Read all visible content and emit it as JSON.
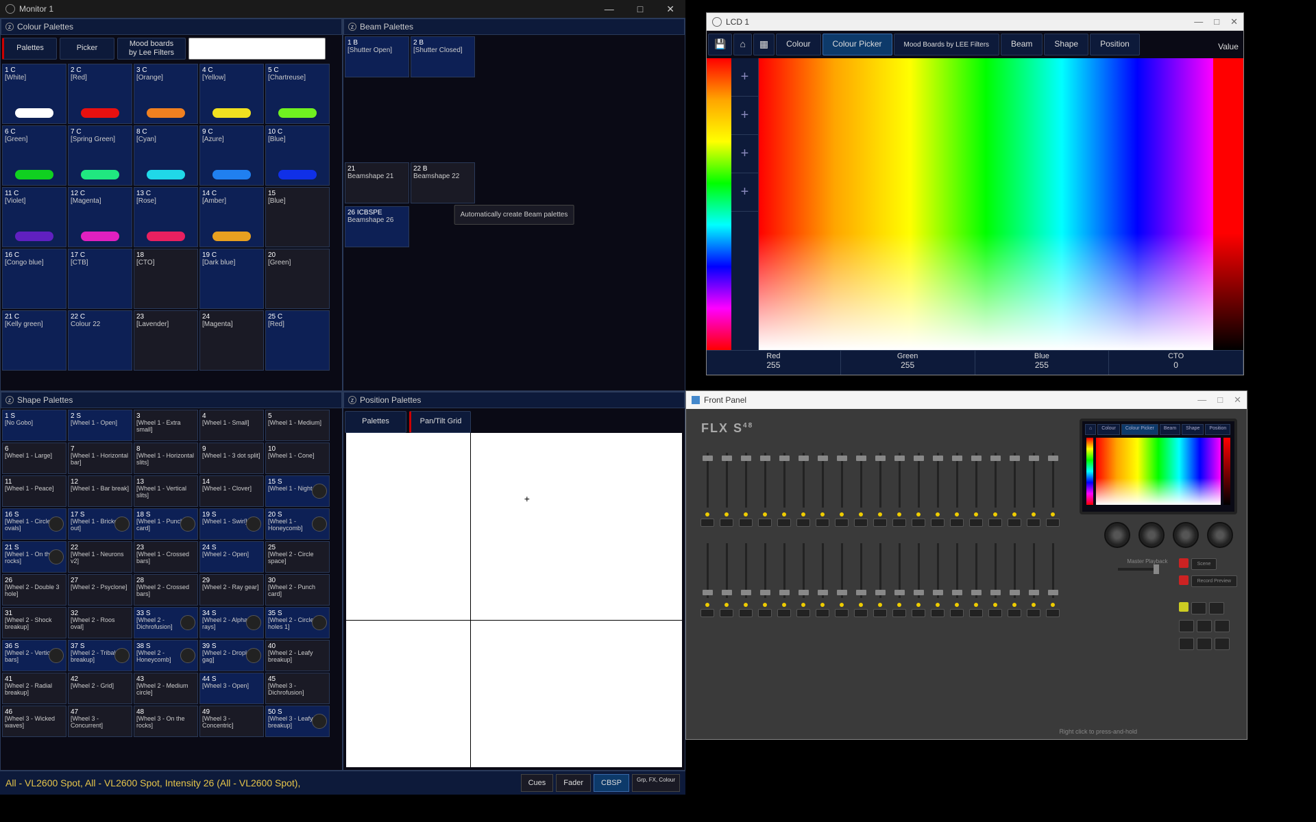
{
  "monitor1": {
    "title": "Monitor 1",
    "colour_panel": {
      "header": "Colour Palettes",
      "tabs": {
        "palettes": "Palettes",
        "picker": "Picker",
        "mood": "Mood boards by Lee Filters"
      },
      "cells": [
        {
          "num": "1 C",
          "name": "[White]",
          "color": "#ffffff"
        },
        {
          "num": "2 C",
          "name": "[Red]",
          "color": "#e81010"
        },
        {
          "num": "3 C",
          "name": "[Orange]",
          "color": "#f08020"
        },
        {
          "num": "4 C",
          "name": "[Yellow]",
          "color": "#f0e020"
        },
        {
          "num": "5 C",
          "name": "[Chartreuse]",
          "color": "#70f020"
        },
        {
          "num": "6 C",
          "name": "[Green]",
          "color": "#10d020"
        },
        {
          "num": "7 C",
          "name": "[Spring Green]",
          "color": "#20e880"
        },
        {
          "num": "8 C",
          "name": "[Cyan]",
          "color": "#20d8e8"
        },
        {
          "num": "9 C",
          "name": "[Azure]",
          "color": "#2080f0"
        },
        {
          "num": "10 C",
          "name": "[Blue]",
          "color": "#1030e8"
        },
        {
          "num": "11 C",
          "name": "[Violet]",
          "color": "#6020c0"
        },
        {
          "num": "12 C",
          "name": "[Magenta]",
          "color": "#e020c0"
        },
        {
          "num": "13 C",
          "name": "[Rose]",
          "color": "#e82060"
        },
        {
          "num": "14 C",
          "name": "[Amber]",
          "color": "#e8a020"
        },
        {
          "num": "15",
          "name": "[Blue]",
          "dark": true
        },
        {
          "num": "16 C",
          "name": "[Congo blue]"
        },
        {
          "num": "17 C",
          "name": "[CTB]"
        },
        {
          "num": "18",
          "name": "[CTO]",
          "dark": true
        },
        {
          "num": "19 C",
          "name": "[Dark blue]"
        },
        {
          "num": "20",
          "name": "[Green]",
          "dark": true
        },
        {
          "num": "21 C",
          "name": "[Kelly green]"
        },
        {
          "num": "22 C",
          "name": "Colour 22"
        },
        {
          "num": "23",
          "name": "[Lavender]",
          "dark": true
        },
        {
          "num": "24",
          "name": "[Magenta]",
          "dark": true
        },
        {
          "num": "25 C",
          "name": "[Red]"
        }
      ]
    },
    "beam_panel": {
      "header": "Beam Palettes",
      "cells1": [
        {
          "num": "1 B",
          "name": "[Shutter Open]"
        },
        {
          "num": "2 B",
          "name": "[Shutter Closed]"
        }
      ],
      "cells2": [
        {
          "num": "21",
          "name": "Beamshape 21",
          "dark": true
        },
        {
          "num": "22 B",
          "name": "Beamshape 22",
          "dark": true
        }
      ],
      "cells3": [
        {
          "num": "26 ICBSPE",
          "name": "Beamshape 26"
        }
      ],
      "auto_btn": "Automatically create Beam palettes"
    },
    "shape_panel": {
      "header": "Shape Palettes",
      "cells": [
        {
          "num": "1 S",
          "name": "[No Gobo]"
        },
        {
          "num": "2 S",
          "name": "[Wheel 1 - Open]"
        },
        {
          "num": "3",
          "name": "[Wheel 1 - Extra small]",
          "dark": true
        },
        {
          "num": "4",
          "name": "[Wheel 1 - Small]",
          "dark": true
        },
        {
          "num": "5",
          "name": "[Wheel 1 - Medium]",
          "dark": true
        },
        {
          "num": "6",
          "name": "[Wheel 1 - Large]",
          "dark": true
        },
        {
          "num": "7",
          "name": "[Wheel 1 - Horizontal bar]",
          "dark": true
        },
        {
          "num": "8",
          "name": "[Wheel 1 - Horizontal slits]",
          "dark": true
        },
        {
          "num": "9",
          "name": "[Wheel 1 - 3 dot split]",
          "dark": true
        },
        {
          "num": "10",
          "name": "[Wheel 1 - Cone]",
          "dark": true
        },
        {
          "num": "11",
          "name": "[Wheel 1 - Peace]",
          "dark": true
        },
        {
          "num": "12",
          "name": "[Wheel 1 - Bar break]",
          "dark": true
        },
        {
          "num": "13",
          "name": "[Wheel 1 - Vertical slits]",
          "dark": true
        },
        {
          "num": "14",
          "name": "[Wheel 1 - Clover]",
          "dark": true
        },
        {
          "num": "15 S",
          "name": "[Wheel 1 - Night sky]",
          "thumb": true
        },
        {
          "num": "16 S",
          "name": "[Wheel 1 - Circle of ovals]",
          "thumb": true
        },
        {
          "num": "17 S",
          "name": "[Wheel 1 - Bricked out]",
          "thumb": true
        },
        {
          "num": "18 S",
          "name": "[Wheel 1 - Punch card]",
          "thumb": true
        },
        {
          "num": "19 S",
          "name": "[Wheel 1 - Swirl]",
          "thumb": true
        },
        {
          "num": "20 S",
          "name": "[Wheel 1 - Honeycomb]",
          "thumb": true
        },
        {
          "num": "21 S",
          "name": "[Wheel 1 - On the rocks]",
          "thumb": true
        },
        {
          "num": "22",
          "name": "[Wheel 1 - Neurons v2]",
          "dark": true
        },
        {
          "num": "23",
          "name": "[Wheel 1 - Crossed bars]",
          "dark": true
        },
        {
          "num": "24 S",
          "name": "[Wheel 2 - Open]"
        },
        {
          "num": "25",
          "name": "[Wheel 2 - Circle space]",
          "dark": true
        },
        {
          "num": "26",
          "name": "[Wheel 2 - Double 3 hole]",
          "dark": true
        },
        {
          "num": "27",
          "name": "[Wheel 2 - Psyclone]",
          "dark": true
        },
        {
          "num": "28",
          "name": "[Wheel 2 - Crossed bars]",
          "dark": true
        },
        {
          "num": "29",
          "name": "[Wheel 2 - Ray gear]",
          "dark": true
        },
        {
          "num": "30",
          "name": "[Wheel 2 - Punch card]",
          "dark": true
        },
        {
          "num": "31",
          "name": "[Wheel 2 - Shock breakup]",
          "dark": true
        },
        {
          "num": "32",
          "name": "[Wheel 2 - Roos oval]",
          "dark": true
        },
        {
          "num": "33 S",
          "name": "[Wheel 2 - Dichrofusion]",
          "thumb": true
        },
        {
          "num": "34 S",
          "name": "[Wheel 2 - Alpha rays]",
          "thumb": true
        },
        {
          "num": "35 S",
          "name": "[Wheel 2 - Circle of holes 1]",
          "thumb": true
        },
        {
          "num": "36 S",
          "name": "[Wheel 2 - Vertical bars]",
          "thumb": true
        },
        {
          "num": "37 S",
          "name": "[Wheel 2 - Tribal breakup]",
          "thumb": true
        },
        {
          "num": "38 S",
          "name": "[Wheel 2 - Honeycomb]",
          "thumb": true
        },
        {
          "num": "39 S",
          "name": "[Wheel 2 - Droplets gag]",
          "thumb": true
        },
        {
          "num": "40",
          "name": "[Wheel 2 - Leafy breakup]",
          "dark": true
        },
        {
          "num": "41",
          "name": "[Wheel 2 - Radial breakup]",
          "dark": true
        },
        {
          "num": "42",
          "name": "[Wheel 2 - Grid]",
          "dark": true
        },
        {
          "num": "43",
          "name": "[Wheel 2 - Medium circle]",
          "dark": true
        },
        {
          "num": "44 S",
          "name": "[Wheel 3 - Open]"
        },
        {
          "num": "45",
          "name": "[Wheel 3 - Dichrofusion]",
          "dark": true
        },
        {
          "num": "46",
          "name": "[Wheel 3 - Wicked waves]",
          "dark": true
        },
        {
          "num": "47",
          "name": "[Wheel 3 - Concurrent]",
          "dark": true
        },
        {
          "num": "48",
          "name": "[Wheel 3 - On the rocks]",
          "dark": true
        },
        {
          "num": "49",
          "name": "[Wheel 3 - Concentric]",
          "dark": true
        },
        {
          "num": "50 S",
          "name": "[Wheel 3 - Leafy breakup]",
          "thumb": true
        }
      ]
    },
    "position_panel": {
      "header": "Position Palettes",
      "tabs": {
        "palettes": "Palettes",
        "pantilt": "Pan/Tilt Grid"
      }
    }
  },
  "statusbar": {
    "text": "All - VL2600 Spot, All - VL2600 Spot, Intensity 26 (All - VL2600 Spot),",
    "btns": {
      "cues": "Cues",
      "fader": "Fader",
      "cbsp": "CBSP",
      "grpfx": "Grp, FX, Colour"
    }
  },
  "lcd1": {
    "title": "LCD 1",
    "tabs": [
      "Colour",
      "Colour Picker",
      "Mood Boards by LEE Filters",
      "Beam",
      "Shape",
      "Position"
    ],
    "value_label": "Value",
    "rgb": {
      "red_label": "Red",
      "red_val": "255",
      "green_label": "Green",
      "green_val": "255",
      "blue_label": "Blue",
      "blue_val": "255",
      "cto_label": "CTO",
      "cto_val": "0"
    }
  },
  "frontpanel": {
    "title": "Front Panel",
    "brand": "FLX S",
    "brand_sup": "48",
    "master_label": "Master Playback",
    "btn_scene": "Scene",
    "btn_record": "Record Preview",
    "hint": "Right click to press-and-hold"
  }
}
